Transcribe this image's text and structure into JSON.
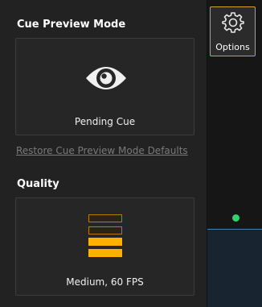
{
  "preview_panel": {
    "cue_preview_title": "Cue Preview Mode",
    "preview_tile_label": "Pending Cue",
    "restore_link": "Restore Cue Preview Mode Defaults",
    "quality_title": "Quality",
    "quality_tile_label": "Medium, 60 FPS",
    "quality_level": 2,
    "quality_level_max": 4
  },
  "toolbar": {
    "options_label": "Options"
  },
  "colors": {
    "accent": "#ffb000",
    "accent_border": "#d4a022",
    "status": "#2fd46a"
  },
  "icons": {
    "preview": "eye-icon",
    "options": "gear-icon"
  }
}
